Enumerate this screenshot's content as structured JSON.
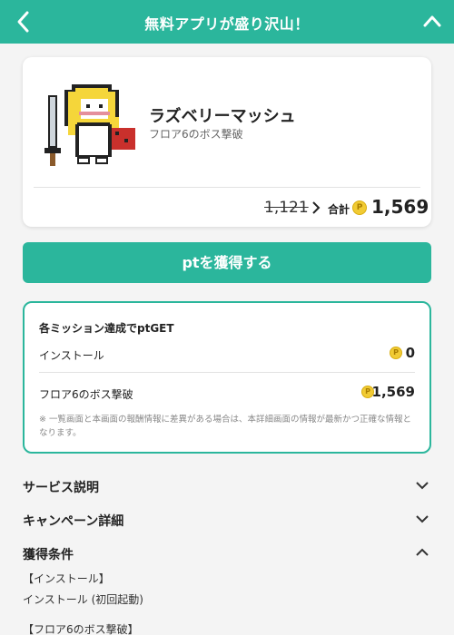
{
  "header": {
    "title": "無料アプリが盛り沢山！",
    "back_icon": "chevron-left-icon",
    "collapse_icon": "chevron-up-icon"
  },
  "app": {
    "name": "ラズベリーマッシュ",
    "subtitle": "フロア6のボス撃破",
    "old_points": "1,121",
    "total_label": "合計",
    "total_points": "1,569",
    "coin_glyph": "P"
  },
  "cta": {
    "label": "ptを獲得する"
  },
  "missions": {
    "title": "各ミッション達成でptGET",
    "items": [
      {
        "label": "インストール",
        "points": "0"
      },
      {
        "label": "フロア6のボス撃破",
        "points": "1,569"
      }
    ],
    "note": "※ 一覧画面と本画面の報酬情報に差異がある場合は、本詳細画面の情報が最新かつ正確な情報となります。"
  },
  "sections": [
    {
      "label": "サービス説明",
      "state": "collapsed"
    },
    {
      "label": "キャンペーン詳細",
      "state": "collapsed"
    },
    {
      "label": "獲得条件",
      "state": "expanded"
    }
  ],
  "conditions": {
    "install_heading": "【インストール】",
    "install_detail": "インストール (初回起動)",
    "boss_heading": "【フロア6のボス撃破】"
  },
  "colors": {
    "accent": "#2bb69c",
    "coin": "#f1cb34",
    "background": "#f4f4f4"
  }
}
